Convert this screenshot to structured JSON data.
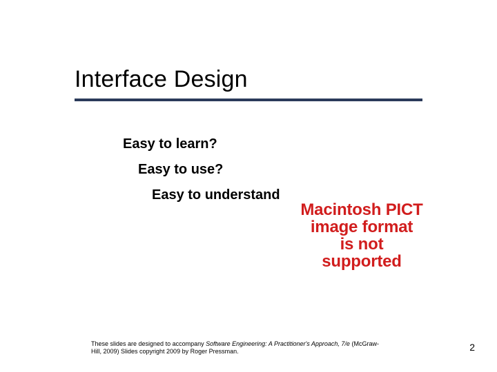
{
  "slide": {
    "title": "Interface Design",
    "lines": {
      "l1": "Easy to learn?",
      "l2": "Easy to use?",
      "l3": "Easy to understand"
    },
    "pict_placeholder": {
      "p1": "Macintosh PICT",
      "p2": "image format",
      "p3": "is not supported"
    },
    "footer": {
      "before": "These slides are designed to accompany ",
      "book": "Software Engineering: A Practitioner's Approach, 7/e",
      "after": " (McGraw-Hill, 2009) Slides copyright 2009 by Roger Pressman."
    },
    "page_number": "2"
  }
}
